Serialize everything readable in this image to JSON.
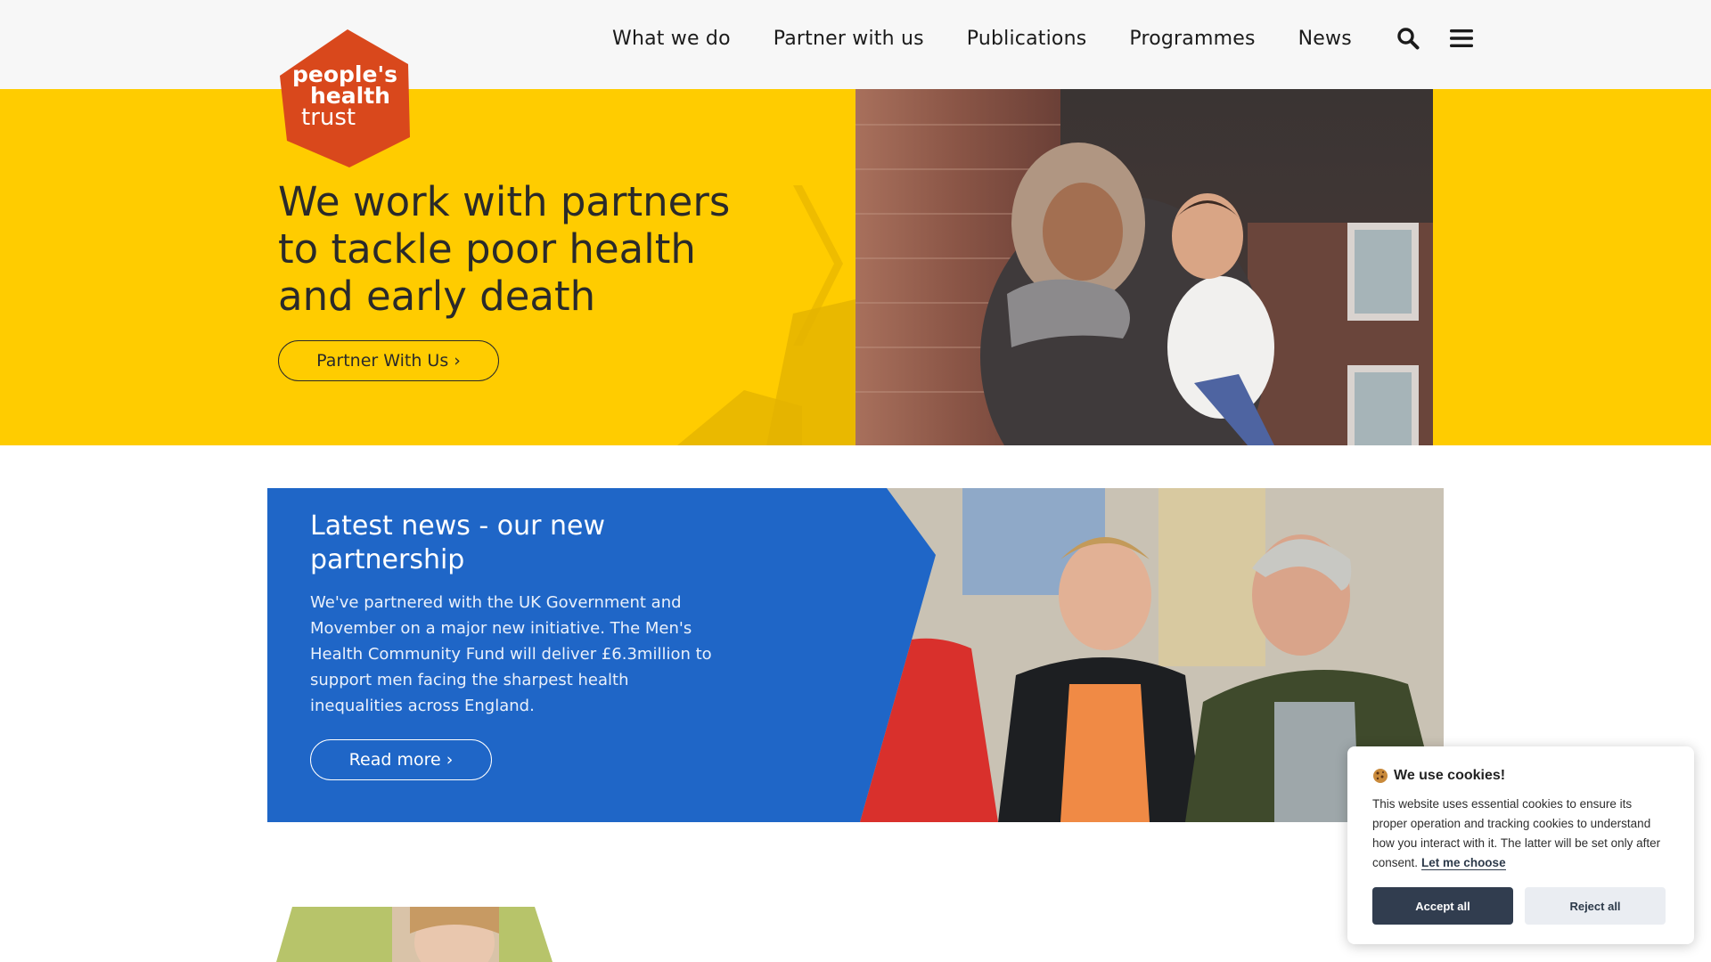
{
  "brand": {
    "logo_line1": "people's",
    "logo_line2": "health",
    "logo_line3": "trust",
    "logo_color": "#d9481c"
  },
  "nav": {
    "items": [
      {
        "label": "What we do"
      },
      {
        "label": "Partner with us"
      },
      {
        "label": "Publications"
      },
      {
        "label": "Programmes"
      },
      {
        "label": "News"
      }
    ],
    "search_icon": "search-icon",
    "menu_icon": "hamburger-menu-icon"
  },
  "hero": {
    "title": "We work with partners to tackle poor health and early death",
    "button_label": "Partner With Us ›",
    "background_color": "#ffcc00",
    "photo": "woman-holding-baby-photo"
  },
  "news": {
    "title": "Latest news - our new partnership",
    "body": "We've partnered with the UK Government and Movember on a major new initiative. The Men's Health Community Fund will deliver £6.3million to support men facing the sharpest health inequalities across England.",
    "button_label": "Read more ›",
    "background_color": "#1f66c7",
    "photo": "three-men-talking-photo"
  },
  "cookie": {
    "emoji": "cookie-icon",
    "title": "We use cookies!",
    "text": "This website uses essential cookies to ensure its proper operation and tracking cookies to understand how you interact with it. The latter will be set only after consent.",
    "link_label": "Let me choose",
    "accept_label": "Accept all",
    "reject_label": "Reject all",
    "accept_color": "#313d4f"
  }
}
